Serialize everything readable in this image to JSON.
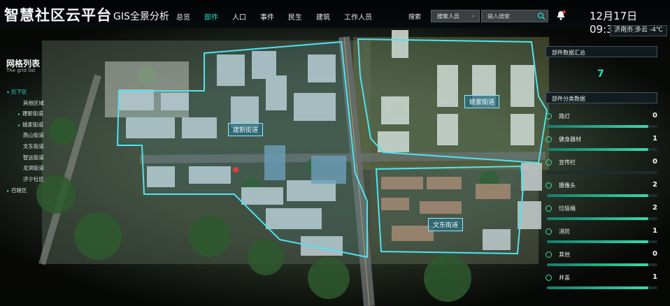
{
  "header": {
    "app_title": "智慧社区云平台",
    "app_subtitle": "GIS全景分析",
    "nav": [
      "总览",
      "部件",
      "人口",
      "事件",
      "民生",
      "建筑",
      "工作人员"
    ],
    "active_nav": "部件",
    "search_label": "搜索",
    "search_select": "搜索人员",
    "search_placeholder": "输入搜索",
    "clock": "12月17日 09:37:59",
    "weather": "济南市  多云  -4℃"
  },
  "grid": {
    "title": "网格列表",
    "subtitle": "The grid list",
    "items": [
      {
        "label": "历下区",
        "level": 0,
        "expand": true
      },
      {
        "label": "其他区域",
        "level": 1,
        "expand": false
      },
      {
        "label": "建新街道",
        "level": 1,
        "expand": true
      },
      {
        "label": "姚家街道",
        "level": 1,
        "expand": true
      },
      {
        "label": "燕山街道",
        "level": 1,
        "expand": false
      },
      {
        "label": "文东街道",
        "level": 1,
        "expand": false
      },
      {
        "label": "智远街道",
        "level": 1,
        "expand": false
      },
      {
        "label": "龙洞街道",
        "level": 1,
        "expand": false
      },
      {
        "label": "济宁社区",
        "level": 1,
        "expand": false
      },
      {
        "label": "召陵区",
        "level": 0,
        "expand": true
      }
    ]
  },
  "districts": [
    "建新街道",
    "姚家街道",
    "文东街道"
  ],
  "summary": {
    "title": "部件数据汇总",
    "total": "7",
    "category_title": "部件分类数据",
    "categories": [
      {
        "name": "路灯",
        "count": "0",
        "fill": 0.92
      },
      {
        "name": "健身器材",
        "count": "1",
        "fill": 0.92
      },
      {
        "name": "宣传栏",
        "count": "0",
        "fill": 0.0
      },
      {
        "name": "摄像头",
        "count": "2",
        "fill": 0.92
      },
      {
        "name": "垃圾桶",
        "count": "2",
        "fill": 0.92
      },
      {
        "name": "消防",
        "count": "1",
        "fill": 0.92
      },
      {
        "name": "其他",
        "count": "0",
        "fill": 0.92
      },
      {
        "name": "井盖",
        "count": "1",
        "fill": 0.92
      }
    ]
  },
  "colors": {
    "accent": "#27e0c6",
    "boundary": "#4fe3ee",
    "bar": "#39d9a8"
  }
}
